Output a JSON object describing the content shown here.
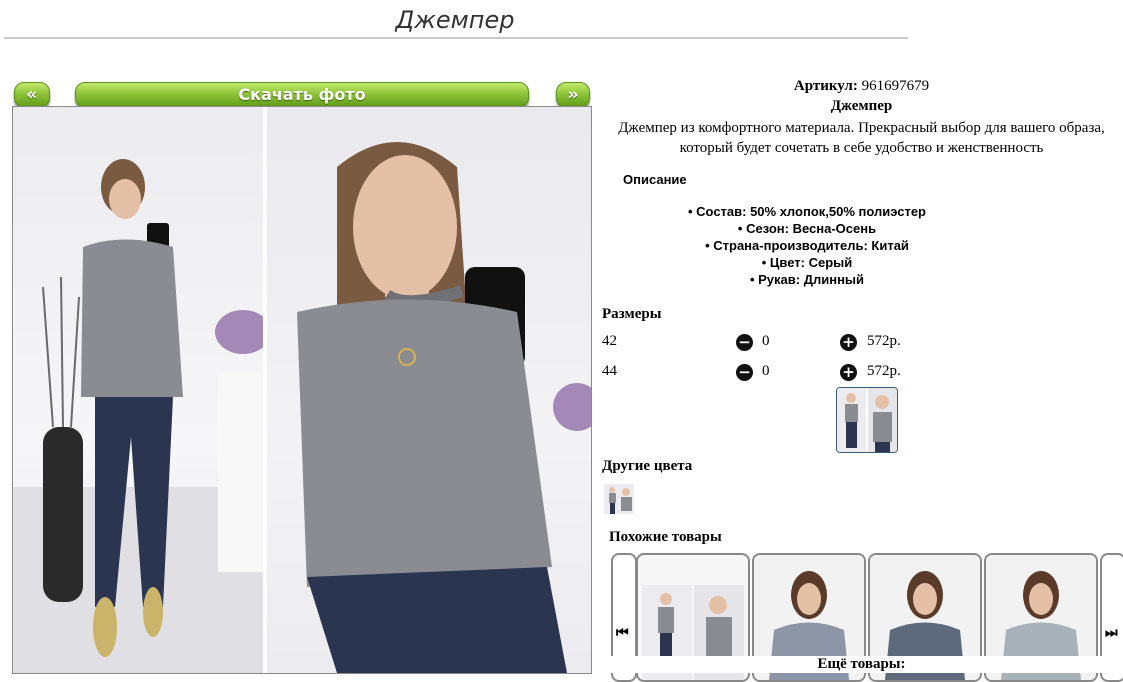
{
  "page": {
    "title": "Джемпер"
  },
  "nav": {
    "prev": "«",
    "download": "Скачать фото",
    "next": "»"
  },
  "product": {
    "sku_label": "Артикул:",
    "sku_value": "961697679",
    "name": "Джемпер",
    "description": "Джемпер из комфортного материала. Прекрасный выбор для вашего образа, который будет сочетать в себе удобство и женственность"
  },
  "details": {
    "heading": "Описание",
    "attributes": [
      "Состав: 50% хлопок,50% полиэстер",
      "Сезон: Весна-Осень",
      "Страна-производитель: Китай",
      "Цвет: Серый",
      "Рукав: Длинный"
    ]
  },
  "sizes": {
    "heading": "Размеры",
    "rows": [
      {
        "size": "42",
        "qty": "0",
        "price": "572р."
      },
      {
        "size": "44",
        "qty": "0",
        "price": "572р."
      }
    ]
  },
  "other_colors": {
    "heading": "Другие цвета"
  },
  "similar": {
    "heading": "Похожие товары",
    "more": "Ещё товары:"
  },
  "colors": {
    "accent_green": "#8fc43a",
    "sweater_gray": "#8a8c91",
    "jeans_blue": "#2b3550"
  }
}
